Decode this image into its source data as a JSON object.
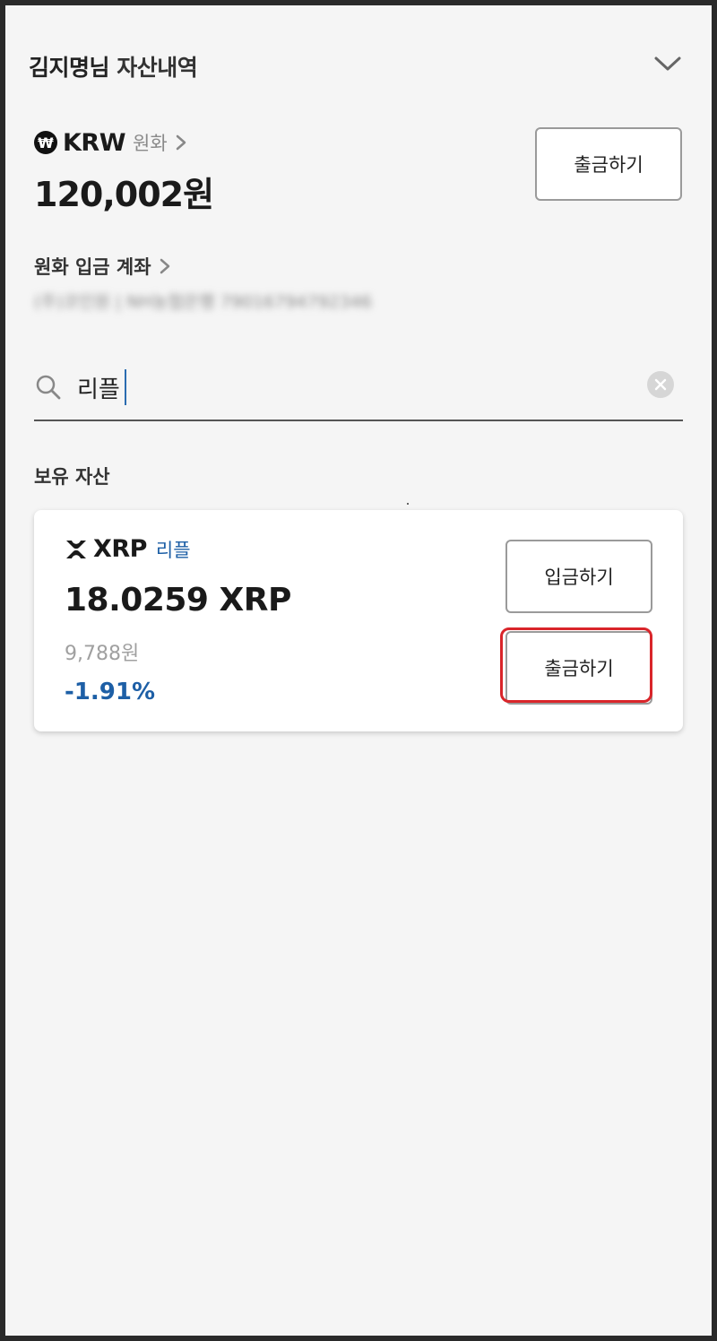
{
  "header": {
    "user_name": "김지명님",
    "title": "자산내역"
  },
  "krw": {
    "icon": "won-icon",
    "badge_symbol": "₩",
    "code": "KRW",
    "name": "원화",
    "amount": "120,002원",
    "withdraw_label": "출금하기"
  },
  "deposit_account": {
    "label": "원화 입금 계좌",
    "value": "(주)코인원 | NH농협은행 79016794792346"
  },
  "search": {
    "value": "리플",
    "placeholder": ""
  },
  "holdings": {
    "label": "보유 자산",
    "assets": [
      {
        "symbol": "XRP",
        "name": "리플",
        "balance": "18.0259 XRP",
        "krw_value": "9,788원",
        "change": "-1.91%",
        "deposit_label": "입금하기",
        "withdraw_label": "출금하기",
        "withdraw_highlighted": true
      }
    ]
  },
  "colors": {
    "background": "#f5f5f5",
    "accent_blue": "#1d5fa6",
    "highlight_red": "#d9252a",
    "text_primary": "#1a1a1a",
    "text_muted": "#a0a0a0"
  }
}
